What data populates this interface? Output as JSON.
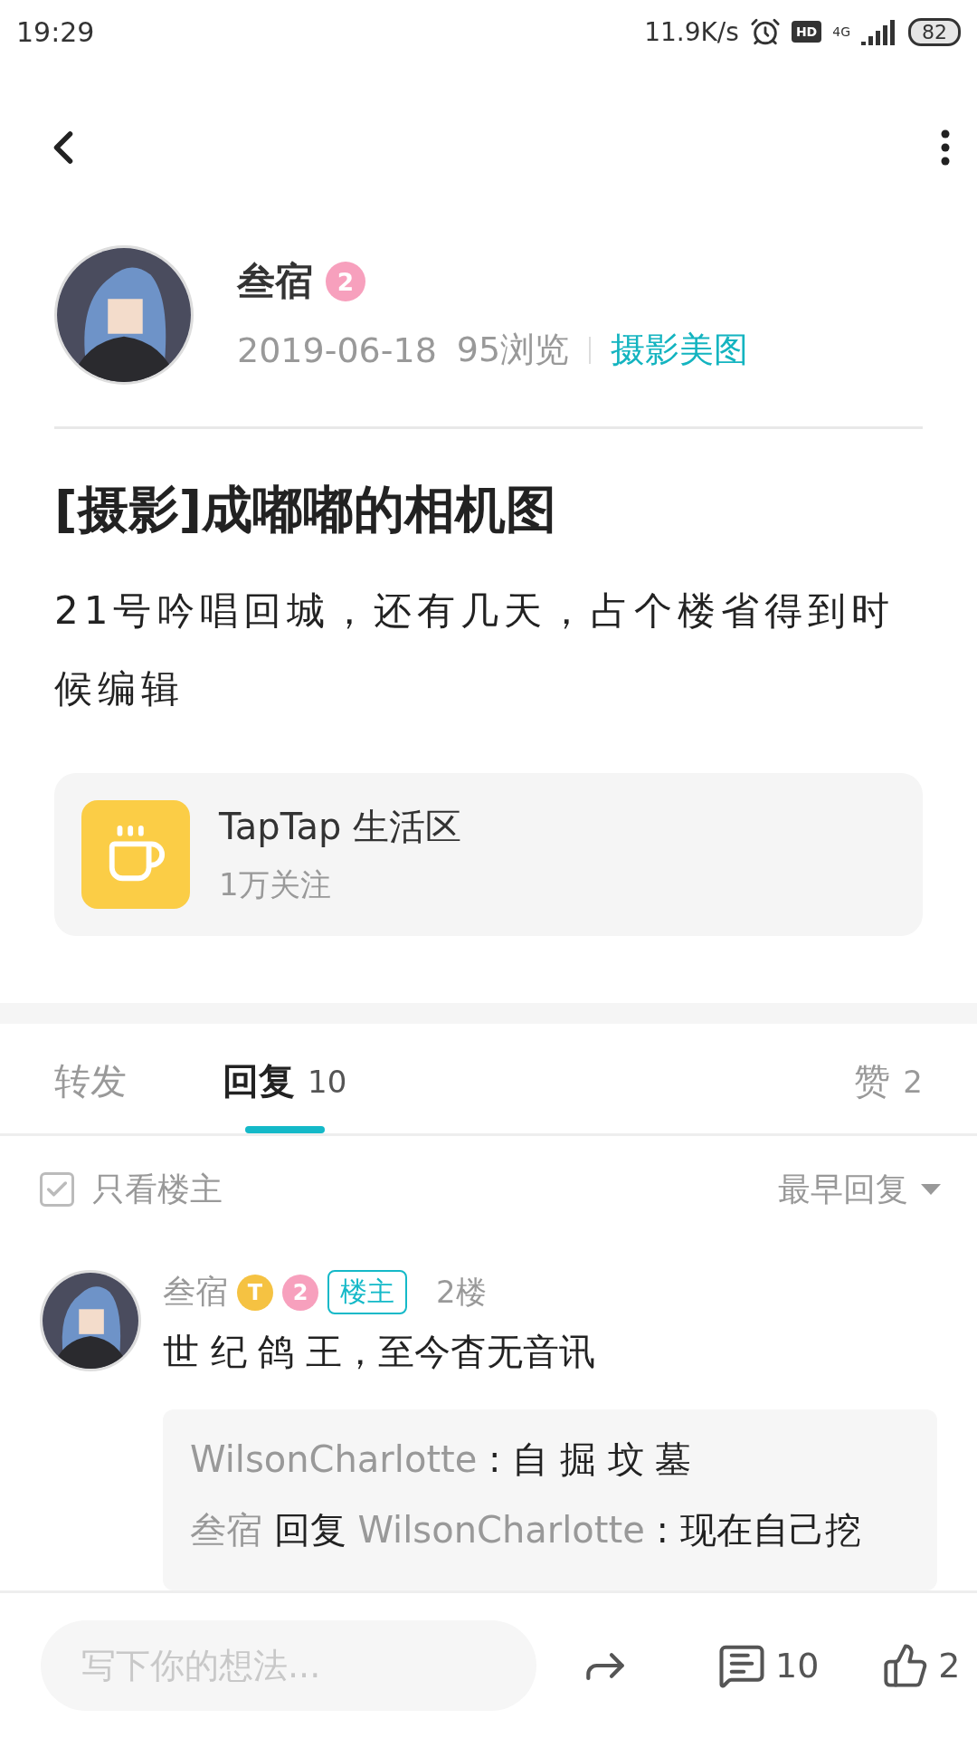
{
  "status_bar": {
    "time": "19:29",
    "net_speed": "11.9K/s",
    "network": "4G",
    "battery": "82",
    "hd": "HD"
  },
  "post": {
    "author": "叁宿",
    "level": "2",
    "date": "2019-06-18",
    "views": "95浏览",
    "category": "摄影美图",
    "title": "[摄影]成嘟嘟的相机图",
    "body": "21号吟唱回城，还有几天，占个楼省得到时候编辑",
    "community": {
      "name": "TapTap 生活区",
      "followers": "1万关注"
    }
  },
  "tabs": [
    {
      "label": "转发",
      "selected": false
    },
    {
      "label": "回复",
      "count": "10",
      "selected": true
    },
    {
      "label": "赞",
      "count": "2",
      "selected": false
    }
  ],
  "filter": {
    "label": "只看楼主",
    "checked": true,
    "sort": "最早回复"
  },
  "comments": [
    {
      "author": "叁宿",
      "badge": "T",
      "level": "2",
      "tag": "楼主",
      "floor": "2楼",
      "text": "世 纪 鸽 王，至今杳无音讯",
      "replies": [
        {
          "kind": "comment",
          "author": "WilsonCharlotte",
          "separator": ":",
          "text": "自 掘 坟 墓"
        },
        {
          "kind": "reply",
          "author": "叁宿",
          "verb": "回复",
          "target": "WilsonCharlotte",
          "separator": ":",
          "text": "现在自己挖"
        }
      ]
    }
  ],
  "bottom_bar": {
    "placeholder": "写下你的想法...",
    "comments": "10",
    "likes": "2"
  }
}
